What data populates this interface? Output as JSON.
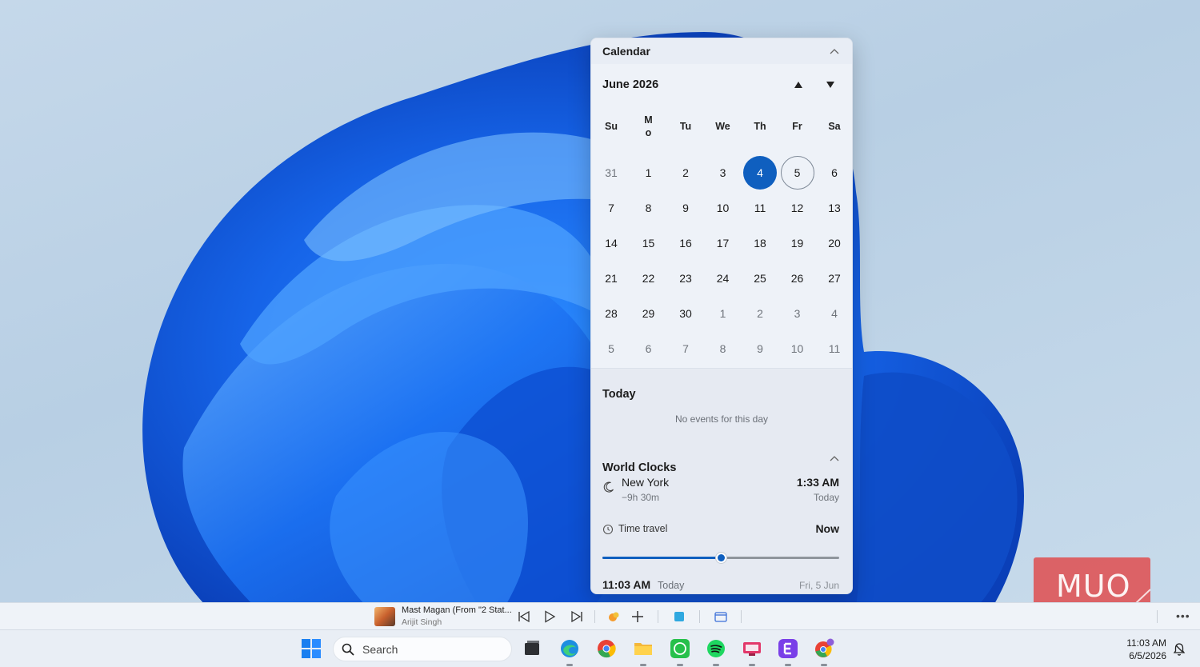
{
  "flyout": {
    "header_title": "Calendar",
    "month_label": "June 2026",
    "weekdays": [
      "Su",
      "M\no",
      "Tu",
      "We",
      "Th",
      "Fr",
      "Sa"
    ],
    "weeks": [
      [
        {
          "d": "31",
          "m": true
        },
        {
          "d": "1"
        },
        {
          "d": "2"
        },
        {
          "d": "3"
        },
        {
          "d": "4",
          "sel": true
        },
        {
          "d": "5",
          "today": true
        },
        {
          "d": "6"
        }
      ],
      [
        {
          "d": "7"
        },
        {
          "d": "8"
        },
        {
          "d": "9"
        },
        {
          "d": "10"
        },
        {
          "d": "11"
        },
        {
          "d": "12"
        },
        {
          "d": "13"
        }
      ],
      [
        {
          "d": "14"
        },
        {
          "d": "15"
        },
        {
          "d": "16"
        },
        {
          "d": "17"
        },
        {
          "d": "18"
        },
        {
          "d": "19"
        },
        {
          "d": "20"
        }
      ],
      [
        {
          "d": "21"
        },
        {
          "d": "22"
        },
        {
          "d": "23"
        },
        {
          "d": "24"
        },
        {
          "d": "25"
        },
        {
          "d": "26"
        },
        {
          "d": "27"
        }
      ],
      [
        {
          "d": "28"
        },
        {
          "d": "29"
        },
        {
          "d": "30"
        },
        {
          "d": "1",
          "m": true
        },
        {
          "d": "2",
          "m": true
        },
        {
          "d": "3",
          "m": true
        },
        {
          "d": "4",
          "m": true
        }
      ],
      [
        {
          "d": "5",
          "m": true
        },
        {
          "d": "6",
          "m": true
        },
        {
          "d": "7",
          "m": true
        },
        {
          "d": "8",
          "m": true
        },
        {
          "d": "9",
          "m": true
        },
        {
          "d": "10",
          "m": true
        },
        {
          "d": "11",
          "m": true
        }
      ]
    ],
    "today_section": {
      "title": "Today",
      "empty_text": "No events for this day"
    },
    "world_clocks": {
      "title": "World Clocks",
      "clock": {
        "city": "New York",
        "offset": "−9h 30m",
        "time": "1:33 AM",
        "day": "Today"
      }
    },
    "time_travel": {
      "label": "Time travel",
      "value": "Now",
      "slider_fraction": 0.5
    },
    "footer": {
      "time": "11:03 AM",
      "day_label": "Today",
      "date": "Fri, 5 Jun"
    }
  },
  "media": {
    "title": "Mast Magan (From \"2 Stat...",
    "artist": "Arijit Singh"
  },
  "watermark": {
    "text": "MUO"
  },
  "taskbar": {
    "search_placeholder": "Search",
    "clock_time": "11:03 AM",
    "clock_date": "6/5/2026"
  },
  "colors": {
    "accent": "#0f5fbf",
    "wallpaper_blue": "#1a6ff0"
  }
}
